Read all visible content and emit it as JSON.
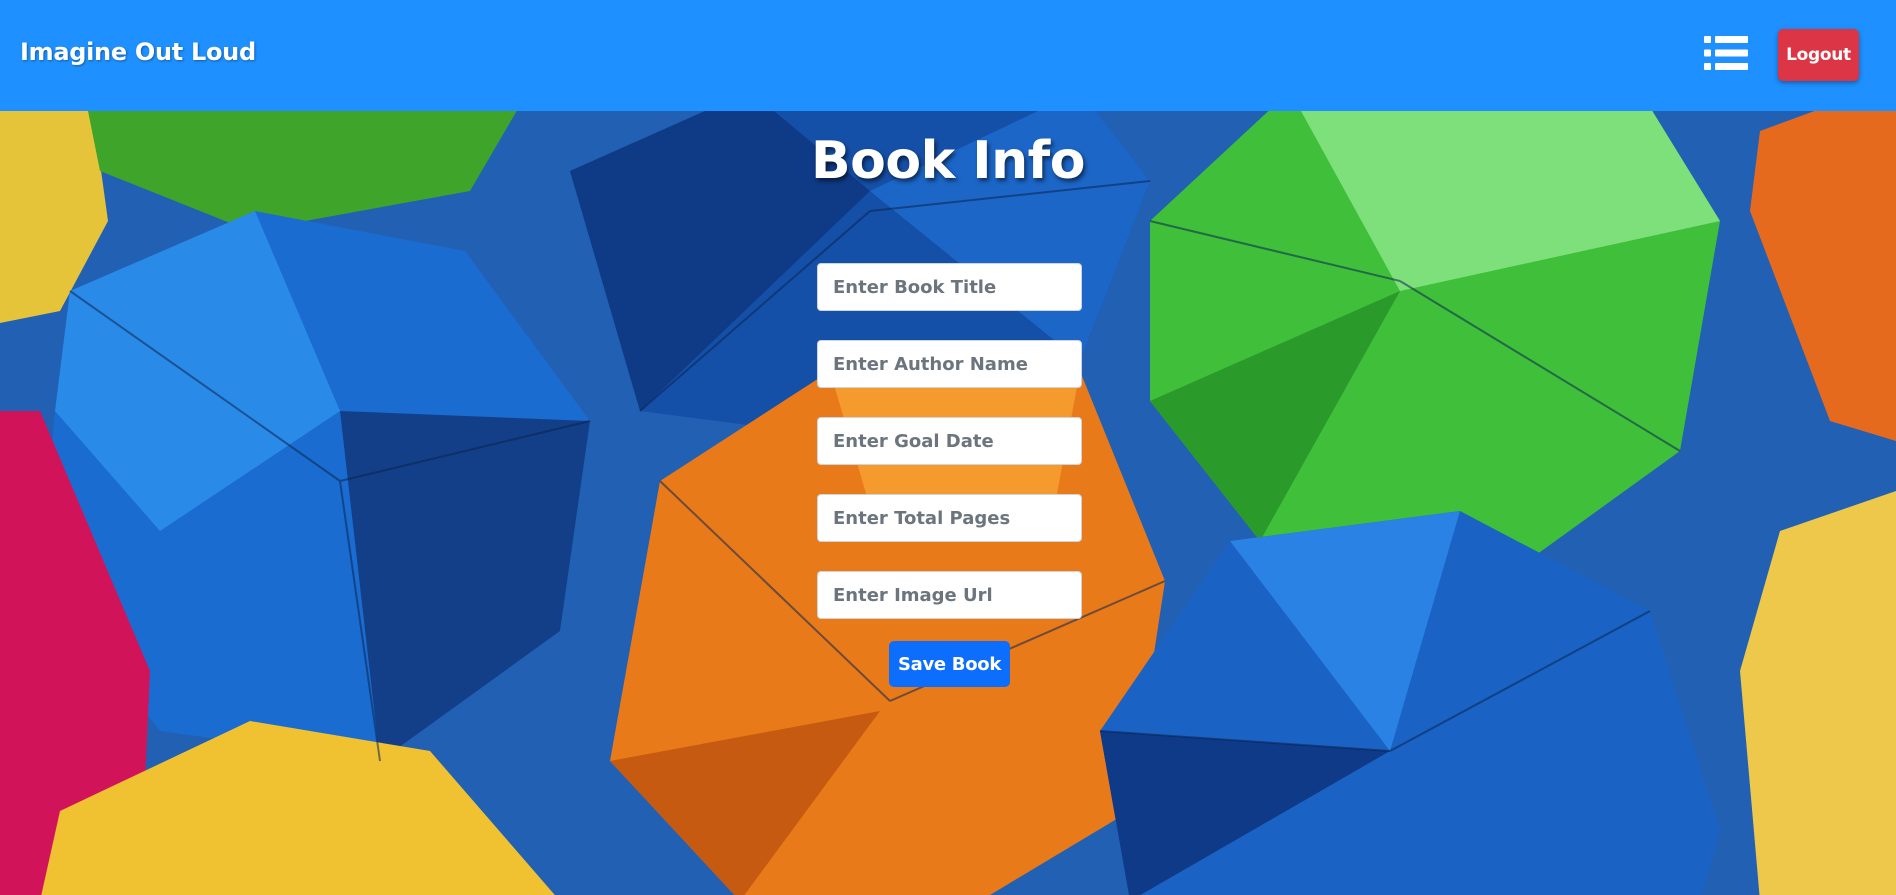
{
  "app": {
    "brand": "Imagine Out Loud",
    "logout_label": "Logout",
    "menu_icon": "list-icon"
  },
  "page": {
    "title": "Book Info"
  },
  "form": {
    "title_placeholder": "Enter Book Title",
    "author_placeholder": "Enter Author Name",
    "goal_date_placeholder": "Enter Goal Date",
    "total_pages_placeholder": "Enter Total Pages",
    "image_url_placeholder": "Enter Image Url",
    "save_label": "Save Book"
  },
  "colors": {
    "navbar": "#1e90ff",
    "logout": "#dc3545",
    "save": "#0d6efd",
    "background_sky": "#1f5fb0"
  }
}
